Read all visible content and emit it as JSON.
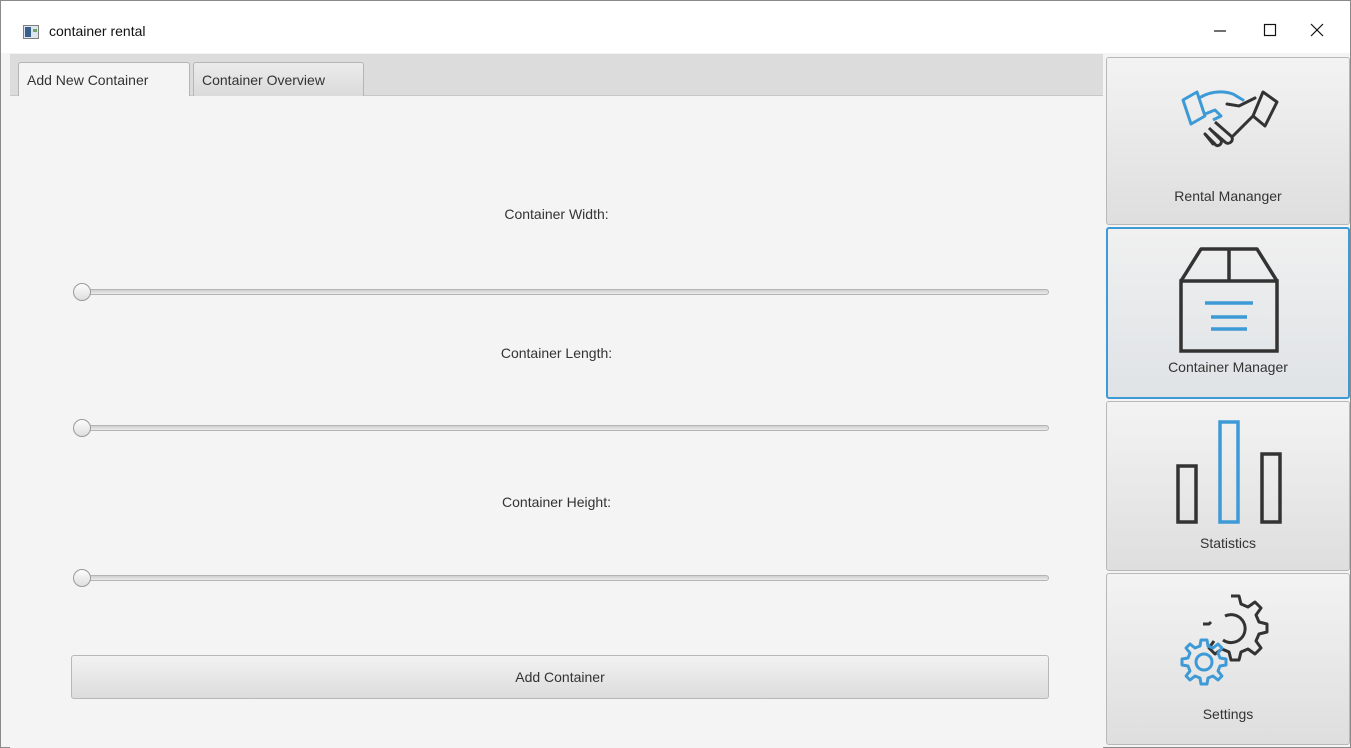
{
  "window": {
    "title": "container rental",
    "controls": {
      "minimize_icon": "minimize-icon",
      "maximize_icon": "maximize-icon",
      "close_icon": "close-icon"
    }
  },
  "tabs": [
    {
      "label": "Add New Container",
      "selected": true
    },
    {
      "label": "Container Overview",
      "selected": false
    }
  ],
  "form": {
    "width_label": "Container Width:",
    "length_label": "Container Length:",
    "height_label": "Container Height:",
    "width_value": 0,
    "length_value": 0,
    "height_value": 0,
    "add_button_label": "Add Container"
  },
  "nav": [
    {
      "label": "Rental Mananger",
      "icon": "handshake-icon",
      "selected": false
    },
    {
      "label": "Container Manager",
      "icon": "box-icon",
      "selected": true
    },
    {
      "label": "Statistics",
      "icon": "bar-chart-icon",
      "selected": false
    },
    {
      "label": "Settings",
      "icon": "gears-icon",
      "selected": false
    }
  ],
  "colors": {
    "accent": "#3d9ad6",
    "icon_dark": "#333333",
    "icon_blue": "#3d9ad6"
  }
}
